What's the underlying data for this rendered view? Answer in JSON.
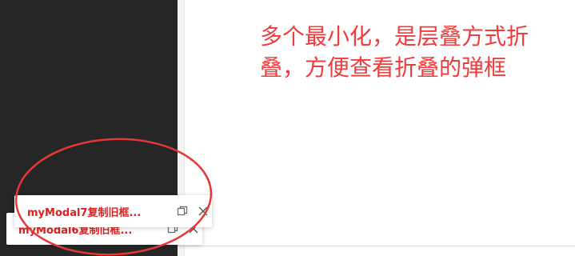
{
  "annotation": {
    "text": "多个最小化，是层叠方式折叠，方便查看折叠的弹框"
  },
  "minimized_modals": [
    {
      "title": "myModal7复制旧框...",
      "restore_icon": "restore-icon",
      "close_icon": "close-icon"
    },
    {
      "title": "myModal6复制旧框...",
      "restore_icon": "restore-icon",
      "close_icon": "close-icon"
    }
  ],
  "colors": {
    "sidebar": "#262626",
    "annotation": "#f03c3c",
    "modal_title": "#e02020",
    "highlight_oval": "#e53935"
  }
}
